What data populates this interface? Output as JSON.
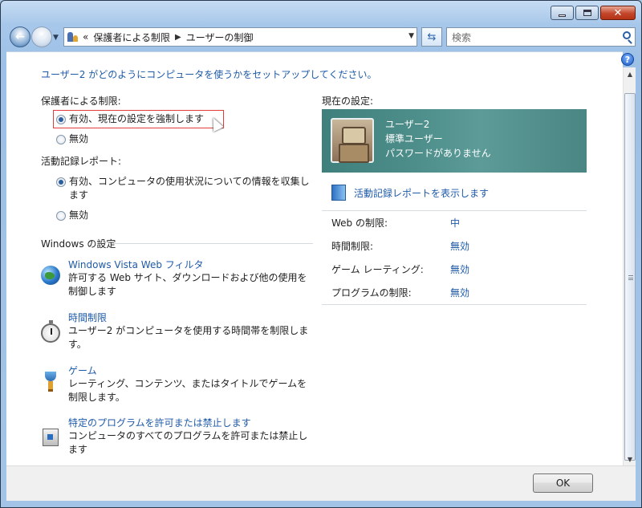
{
  "window": {
    "address": {
      "overflow": "«",
      "crumbs": [
        "保護者による制限",
        "ユーザーの制御"
      ]
    },
    "search_placeholder": "検索"
  },
  "intro": "ユーザー2 がどのようにコンピュータを使うかをセットアップしてください。",
  "parental_controls": {
    "label": "保護者による制限:",
    "options": [
      {
        "label": "有効、現在の設定を強制します",
        "checked": true
      },
      {
        "label": "無効",
        "checked": false
      }
    ]
  },
  "activity_reporting": {
    "label": "活動記録レポート:",
    "options": [
      {
        "label": "有効、コンピュータの使用状況についての情報を収集します",
        "checked": true
      },
      {
        "label": "無効",
        "checked": false
      }
    ]
  },
  "windows_settings": {
    "label": "Windows の設定",
    "items": [
      {
        "link": "Windows Vista Web フィルタ",
        "desc": "許可する Web サイト、ダウンロードおよび他の使用を制御します",
        "icon": "globe-icon"
      },
      {
        "link": "時間制限",
        "desc": "ユーザー2 がコンピュータを使用する時間帯を制限します。",
        "icon": "stopwatch-icon"
      },
      {
        "link": "ゲーム",
        "desc": "レーティング、コンテンツ、またはタイトルでゲームを制限します。",
        "icon": "trophy-icon"
      },
      {
        "link": "特定のプログラムを許可または禁止します",
        "desc": "コンピュータのすべてのプログラムを許可または禁止します",
        "icon": "program-icon"
      }
    ]
  },
  "current_settings": {
    "label": "現在の設定:",
    "user": {
      "name": "ユーザー2",
      "type": "標準ユーザー",
      "password": "パスワードがありません"
    },
    "report_link": "活動記録レポートを表示します",
    "rows": [
      {
        "key": "Web の制限:",
        "value": "中"
      },
      {
        "key": "時間制限:",
        "value": "無効"
      },
      {
        "key": "ゲーム レーティング:",
        "value": "無効"
      },
      {
        "key": "プログラムの制限:",
        "value": "無効"
      }
    ]
  },
  "ok_label": "OK",
  "help_symbol": "?",
  "colors": {
    "link": "#1e5aa8",
    "user_card": "#4d8e8a",
    "highlight_border": "#e23c3c"
  }
}
